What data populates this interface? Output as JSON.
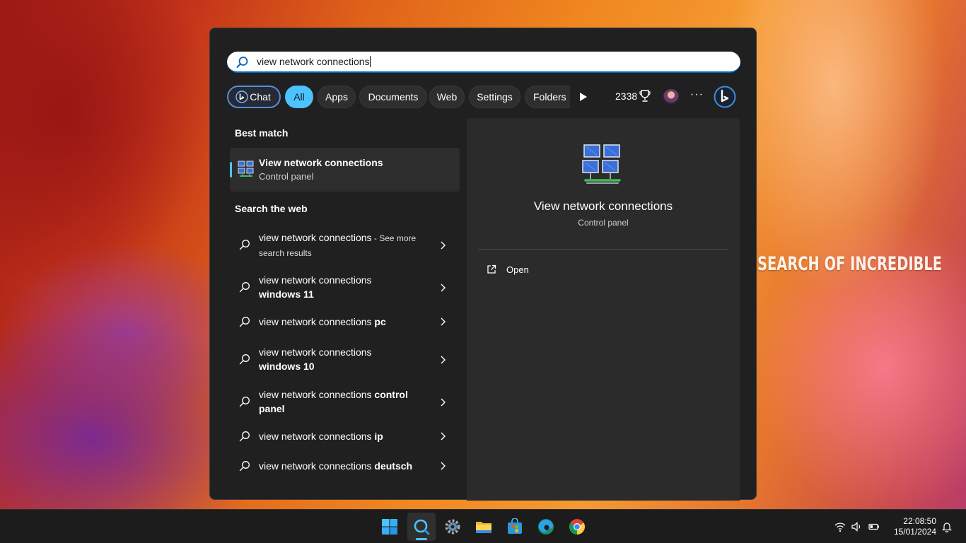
{
  "wallpaper": {
    "overlay_text": "SEARCH OF INCREDIBLE"
  },
  "search": {
    "query": "view network connections"
  },
  "filters": {
    "chat": "Chat",
    "all": "All",
    "apps": "Apps",
    "documents": "Documents",
    "web": "Web",
    "settings": "Settings",
    "folders": "Folders",
    "points": "2338",
    "more": "···"
  },
  "best_match": {
    "heading": "Best match",
    "title": "View network connections",
    "subtitle": "Control panel",
    "icon": "network-connections-icon"
  },
  "web": {
    "heading": "Search the web",
    "results": [
      {
        "prefix": "view network connections",
        "bold": "",
        "suffix": " - See more search results"
      },
      {
        "prefix": "view network connections ",
        "bold": "windows 11",
        "suffix": ""
      },
      {
        "prefix": "view network connections ",
        "bold": "pc",
        "suffix": ""
      },
      {
        "prefix": "view network connections ",
        "bold": "windows 10",
        "suffix": ""
      },
      {
        "prefix": "view network connections ",
        "bold": "control panel",
        "suffix": ""
      },
      {
        "prefix": "view network connections ",
        "bold": "ip",
        "suffix": ""
      },
      {
        "prefix": "view network connections ",
        "bold": "deutsch",
        "suffix": ""
      }
    ]
  },
  "detail": {
    "title": "View network connections",
    "subtitle": "Control panel",
    "open_label": "Open"
  },
  "taskbar": {
    "apps": [
      "start",
      "search",
      "settings",
      "file-explorer",
      "microsoft-store",
      "edge",
      "chrome"
    ],
    "active": "search",
    "time": "22:08:50",
    "date": "15/01/2024"
  },
  "colors": {
    "accent": "#4cc2ff",
    "panel_bg": "#202020",
    "detail_bg": "#2b2b2b",
    "taskbar_bg": "#1c1c1c"
  }
}
